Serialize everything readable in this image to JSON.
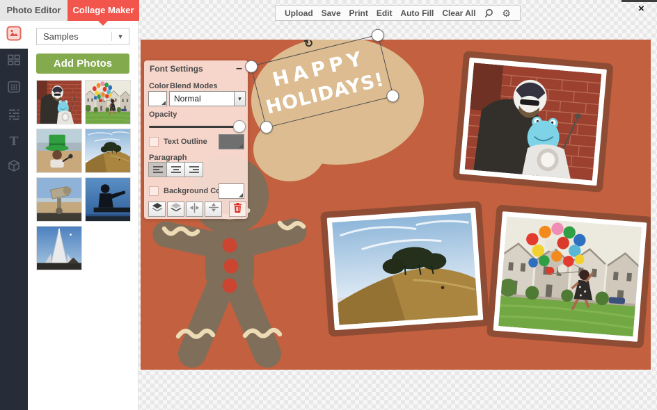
{
  "window": {
    "close_glyph": "×"
  },
  "tabs": {
    "photo_editor": "Photo Editor",
    "collage_maker": "Collage Maker"
  },
  "toolbar": {
    "items": [
      "Upload",
      "Save",
      "Print",
      "Edit",
      "Auto Fill",
      "Clear All"
    ],
    "settings_glyph": "⚙"
  },
  "sidebar": {
    "text_glyph": "T",
    "items": [
      "image-manager",
      "layouts",
      "grid",
      "patterns",
      "text",
      "graphics"
    ],
    "active_item": "image-manager"
  },
  "library": {
    "source_value": "Samples",
    "chevron_glyph": "▾",
    "add_photos_label": "Add Photos",
    "thumbnails": [
      "man-on-scooter",
      "woman-with-balloons",
      "st-patricks-performer",
      "hill-with-trees",
      "coin-telescope",
      "silhouette-by-the-sea",
      "pyramid-tower"
    ]
  },
  "font_panel": {
    "title": "Font Settings",
    "collapse_glyph": "–",
    "color_label": "Color",
    "blend_modes_label": "Blend Modes",
    "blend_mode_value": "Normal",
    "dropdown_glyph": "▾",
    "opacity_label": "Opacity",
    "opacity_percent": 100,
    "text_outline_label": "Text Outline",
    "text_outline_checked": false,
    "paragraph_label": "Paragraph",
    "align_active": "align-left",
    "background_color_label": "Background Color",
    "background_color_checked": false,
    "actions": [
      "bring-forward",
      "send-backward",
      "flip-horizontal",
      "flip-vertical",
      "delete"
    ]
  },
  "canvas": {
    "headline": {
      "line1": "HAPPY",
      "line2": "HOLIDAYS!"
    },
    "rotate_glyph": "↻",
    "photos": [
      "man-on-scooter",
      "hill-with-trees",
      "woman-with-balloons"
    ],
    "colors": {
      "canvas_background": "#c2603f",
      "speech_bubble": "#dcbc90",
      "gingerbread_body": "#7f6e5a",
      "icing": "#ecdbb4",
      "button_red": "#cb4531",
      "photo_frame": "#8e4c34",
      "headline_text": "#ffffff"
    }
  },
  "theme": {
    "accent_red": "#f1554c",
    "accent_green": "#83aa4c",
    "rail_dark": "#262d38"
  }
}
